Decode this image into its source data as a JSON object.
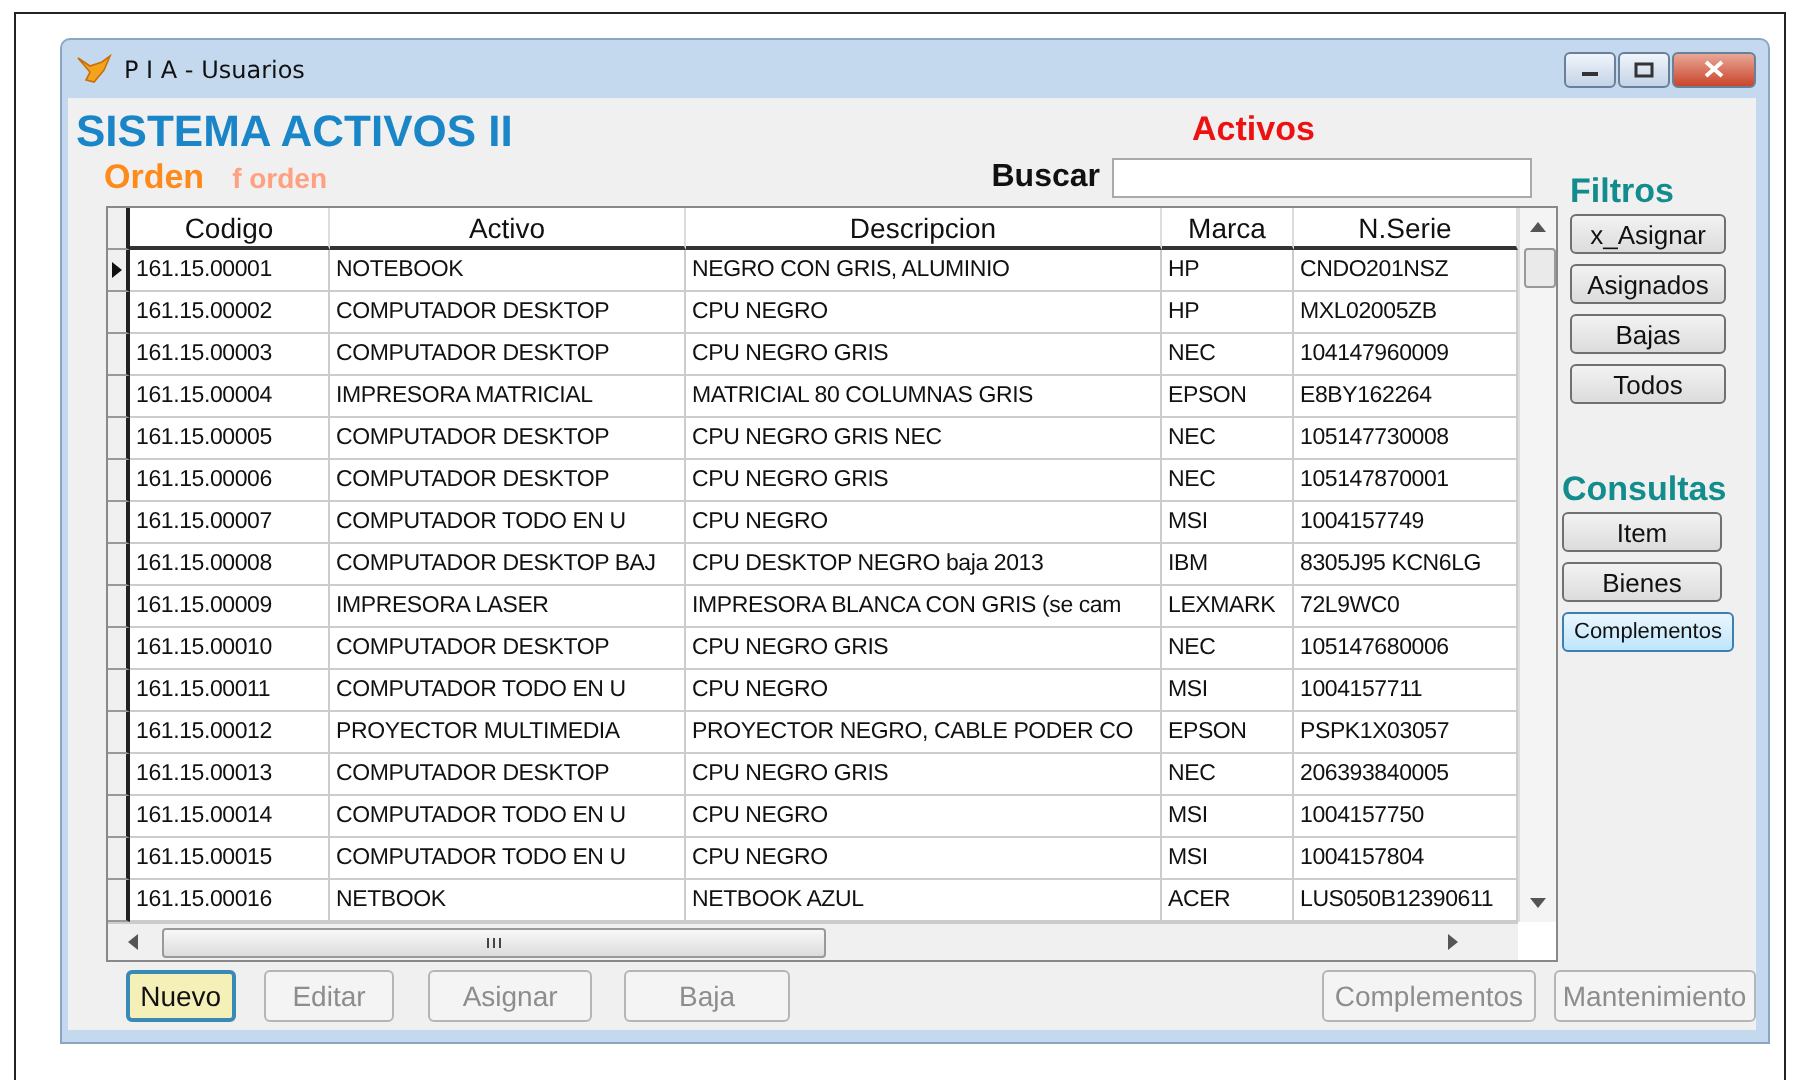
{
  "window": {
    "title": "P I A - Usuarios"
  },
  "header": {
    "title": "SISTEMA ACTIVOS II",
    "subtitle": "Activos",
    "order_label": "Orden",
    "order_value": "f orden"
  },
  "search": {
    "label": "Buscar"
  },
  "table": {
    "columns": [
      "Codigo",
      "Activo",
      "Descripcion",
      "Marca",
      "N.Serie"
    ],
    "rows": [
      {
        "selected": true,
        "cells": [
          "161.15.00001",
          "NOTEBOOK",
          "NEGRO CON GRIS, ALUMINIO",
          "HP",
          "CNDO201NSZ"
        ]
      },
      {
        "selected": false,
        "cells": [
          "161.15.00002",
          "COMPUTADOR DESKTOP",
          "CPU NEGRO",
          "HP",
          "MXL02005ZB"
        ]
      },
      {
        "selected": false,
        "cells": [
          "161.15.00003",
          "COMPUTADOR DESKTOP",
          "CPU NEGRO GRIS",
          "NEC",
          "104147960009"
        ]
      },
      {
        "selected": false,
        "cells": [
          "161.15.00004",
          "IMPRESORA MATRICIAL",
          "MATRICIAL 80 COLUMNAS GRIS",
          "EPSON",
          "E8BY162264"
        ]
      },
      {
        "selected": false,
        "cells": [
          "161.15.00005",
          "COMPUTADOR DESKTOP",
          "CPU NEGRO GRIS NEC",
          "NEC",
          "105147730008"
        ]
      },
      {
        "selected": false,
        "cells": [
          "161.15.00006",
          "COMPUTADOR DESKTOP",
          "CPU NEGRO GRIS",
          "NEC",
          "105147870001"
        ]
      },
      {
        "selected": false,
        "cells": [
          "161.15.00007",
          "COMPUTADOR TODO EN U",
          "CPU NEGRO",
          "MSI",
          "1004157749"
        ]
      },
      {
        "selected": false,
        "cells": [
          "161.15.00008",
          "COMPUTADOR DESKTOP BAJ",
          "CPU DESKTOP NEGRO baja 2013",
          "IBM",
          "8305J95 KCN6LG"
        ]
      },
      {
        "selected": false,
        "cells": [
          "161.15.00009",
          "IMPRESORA LASER",
          "IMPRESORA BLANCA CON GRIS (se cam",
          "LEXMARK",
          "72L9WC0"
        ]
      },
      {
        "selected": false,
        "cells": [
          "161.15.00010",
          "COMPUTADOR DESKTOP",
          "CPU NEGRO GRIS",
          "NEC",
          "105147680006"
        ]
      },
      {
        "selected": false,
        "cells": [
          "161.15.00011",
          "COMPUTADOR TODO EN U",
          "CPU NEGRO",
          "MSI",
          "1004157711"
        ]
      },
      {
        "selected": false,
        "cells": [
          "161.15.00012",
          "PROYECTOR MULTIMEDIA",
          "PROYECTOR NEGRO, CABLE PODER CO",
          "EPSON",
          "PSPK1X03057"
        ]
      },
      {
        "selected": false,
        "cells": [
          "161.15.00013",
          "COMPUTADOR DESKTOP",
          "CPU NEGRO GRIS",
          "NEC",
          "206393840005"
        ]
      },
      {
        "selected": false,
        "cells": [
          "161.15.00014",
          "COMPUTADOR TODO EN U",
          "CPU NEGRO",
          "MSI",
          "1004157750"
        ]
      },
      {
        "selected": false,
        "cells": [
          "161.15.00015",
          "COMPUTADOR TODO EN U",
          "CPU NEGRO",
          "MSI",
          "1004157804"
        ]
      },
      {
        "selected": false,
        "cells": [
          "161.15.00016",
          "NETBOOK",
          "NETBOOK AZUL",
          "ACER",
          "LUS050B12390611"
        ]
      }
    ]
  },
  "filters": {
    "title": "Filtros",
    "buttons": [
      "x_Asignar",
      "Asignados",
      "Bajas",
      "Todos"
    ]
  },
  "queries": {
    "title": "Consultas",
    "buttons": [
      {
        "label": "Item",
        "highlighted": false
      },
      {
        "label": "Bienes",
        "highlighted": false
      },
      {
        "label": "Complementos",
        "highlighted": true
      }
    ]
  },
  "actions": [
    {
      "label": "Nuevo",
      "disabled": false,
      "focused": true
    },
    {
      "label": "Editar",
      "disabled": true,
      "focused": false
    },
    {
      "label": "Asignar",
      "disabled": true,
      "focused": false
    },
    {
      "label": "Baja",
      "disabled": true,
      "focused": false
    },
    {
      "label": "Complementos",
      "disabled": true,
      "focused": false
    },
    {
      "label": "Mantenimiento",
      "disabled": true,
      "focused": false
    }
  ]
}
